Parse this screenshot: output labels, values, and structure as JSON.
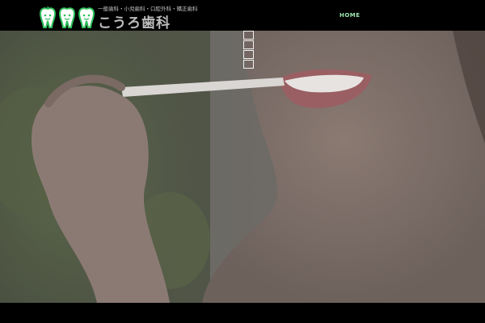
{
  "header": {
    "tagline": "一般歯科・小児歯科・口腔外科・矯正歯科",
    "clinic_name": "こうろ歯科",
    "logo_icon": "tooth-mascot-icon"
  },
  "nav": {
    "items": [
      {
        "label": "HOME"
      }
    ]
  },
  "colors": {
    "background": "#000000",
    "nav_accent": "#9fe8b0",
    "logo_green": "#2fbf5a"
  }
}
